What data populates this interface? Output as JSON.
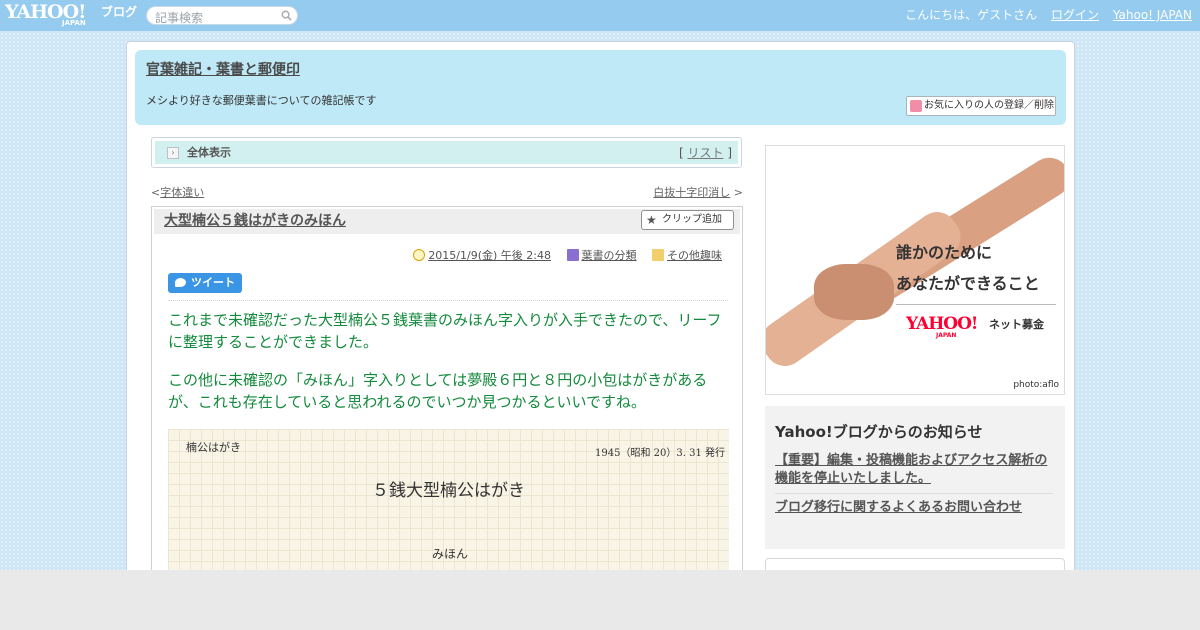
{
  "topbar": {
    "logo_main": "YAHOO!",
    "logo_sub": "JAPAN",
    "logo_blog": "ブログ",
    "search_placeholder": "記事検索",
    "greeting": "こんにちは、ゲストさん",
    "login": "ログイン",
    "yahoo_japan": "Yahoo! JAPAN"
  },
  "blog": {
    "title": "官葉雑記・葉書と郵便印",
    "description": "メシより好きな郵便葉書についての雑記帳です",
    "fav_button": "お気に入りの人の登録／削除"
  },
  "category": {
    "label": "全体表示",
    "bracket_open": "[",
    "list": "リスト",
    "bracket_close": "]"
  },
  "nav": {
    "prev_mark": "<",
    "prev": "字体違い",
    "next": "白抜十字印消し",
    "next_mark": ">"
  },
  "article": {
    "title": "大型楠公５銭はがきのみほん",
    "clip_button": "クリップ追加",
    "date": "2015/1/9(金) 午後 2:48",
    "category1": "葉書の分類",
    "category2": "その他趣味",
    "tweet": "ツイート",
    "paragraph1": "これまで未確認だった大型楠公５銭葉書のみほん字入りが入手できたので、リーフに整理することができました。",
    "paragraph2": "この他に未確認の「みほん」字入りとしては夢殿６円と８円の小包はがきがあるが、これも存在していると思われるのでいつか見つかるといいですね。",
    "image": {
      "label_left": "楠公はがき",
      "label_right": "1945（昭和 20）3. 31 発行",
      "label_center": "５銭大型楠公はがき",
      "label_mihon": "みほん"
    }
  },
  "ad": {
    "line1": "誰かのために",
    "line2": "あなたができること",
    "logo": "YAHOO!",
    "logo_sub": "JAPAN",
    "service": "ネット募金",
    "credit": "photo:aflo"
  },
  "notice": {
    "heading": "Yahoo!ブログからのお知らせ",
    "item1": "【重要】編集・投稿機能およびアクセス解析の機能を停止いたしました。",
    "item2": "ブログ移行に関するよくあるお問い合わせ"
  }
}
